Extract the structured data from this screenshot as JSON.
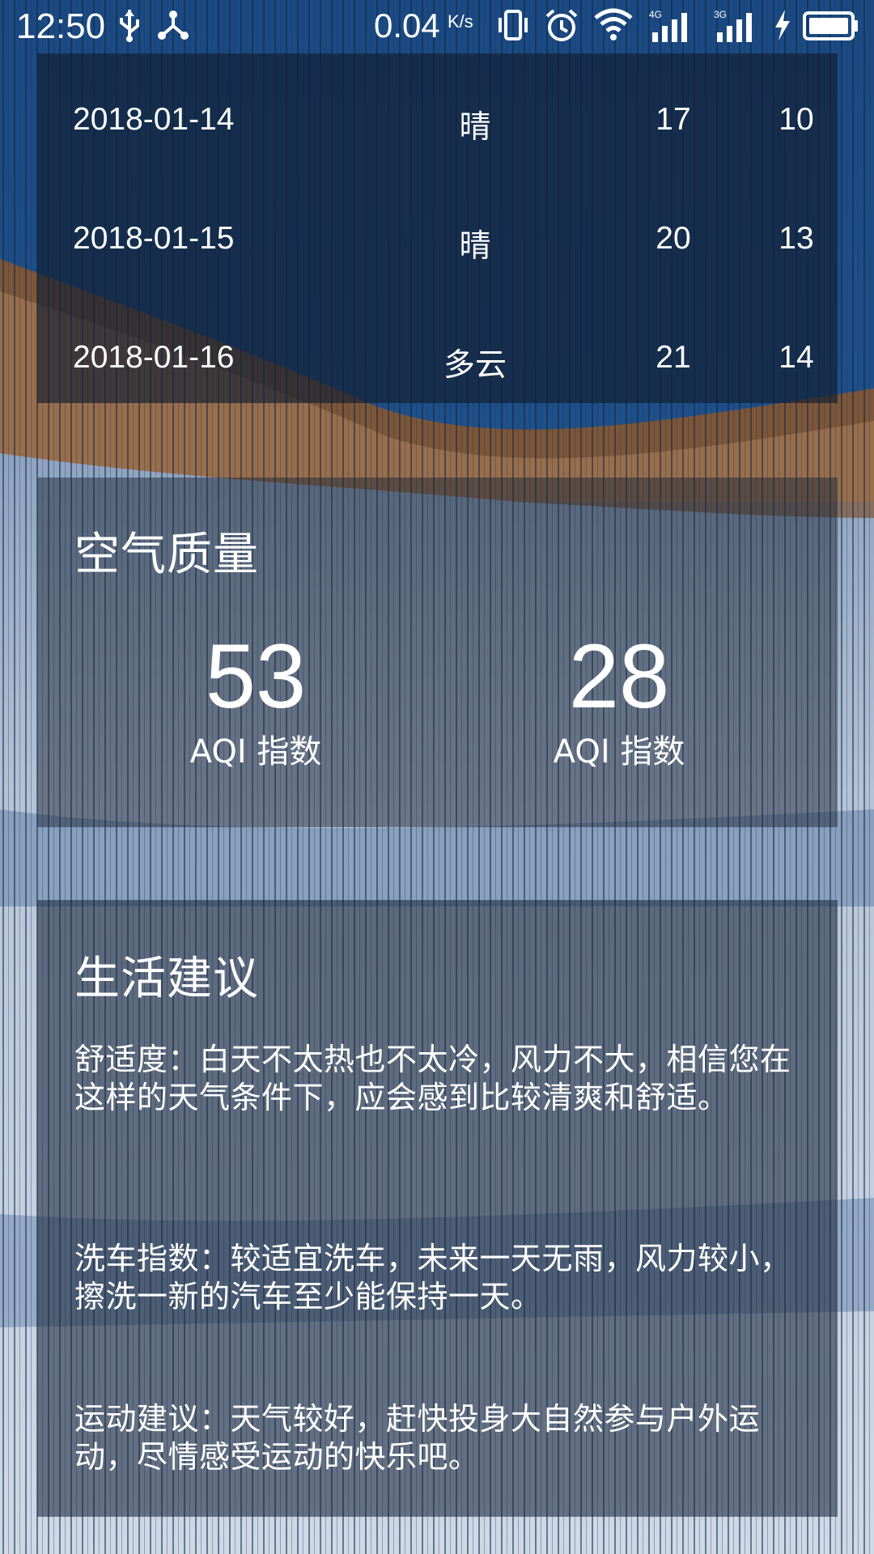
{
  "status_bar": {
    "time": "12:50",
    "net_speed": "0.04",
    "net_speed_unit": "K/s",
    "network_labels": [
      "4G",
      "3G"
    ]
  },
  "forecast": [
    {
      "date": "2018-01-14",
      "weather": "晴",
      "max": "17",
      "min": "10"
    },
    {
      "date": "2018-01-15",
      "weather": "晴",
      "max": "20",
      "min": "13"
    },
    {
      "date": "2018-01-16",
      "weather": "多云",
      "max": "21",
      "min": "14"
    }
  ],
  "aqi": {
    "title": "空气质量",
    "items": [
      {
        "value": "53",
        "label": "AQI 指数"
      },
      {
        "value": "28",
        "label": "AQI 指数"
      }
    ]
  },
  "suggestion": {
    "title": "生活建议",
    "comfort": "舒适度：白天不太热也不太冷，风力不大，相信您在这样的天气条件下，应会感到比较清爽和舒适。",
    "car_wash": "洗车指数：较适宜洗车，未来一天无雨，风力较小，擦洗一新的汽车至少能保持一天。",
    "sport": "运动建议：天气较好，赶快投身大自然参与户外运动，尽情感受运动的快乐吧。"
  },
  "colors": {
    "sky": "#1f5a99",
    "snow": "#c9d6e6",
    "trees": "#9a6a45",
    "panel": "#1a2638"
  }
}
